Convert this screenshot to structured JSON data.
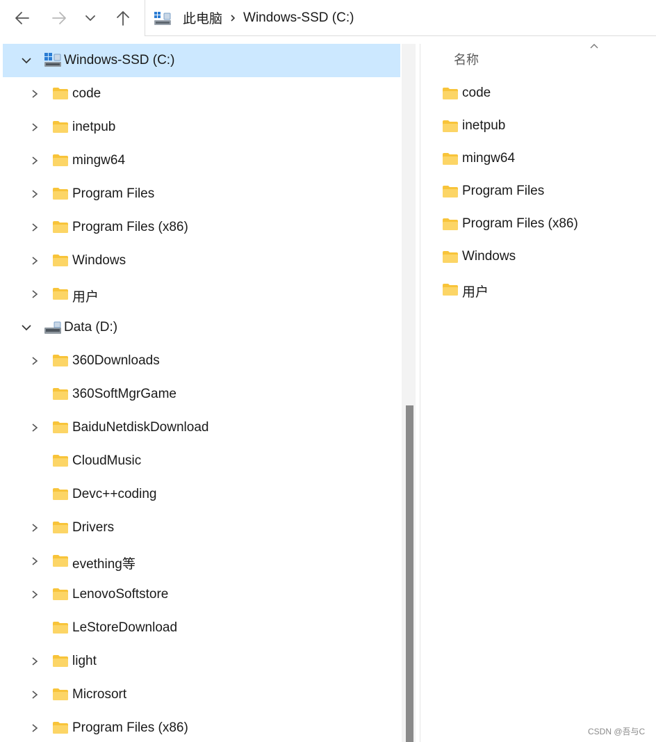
{
  "toolbar": {
    "back_icon": "arrow-left-icon",
    "forward_icon": "arrow-right-icon",
    "recent_icon": "chevron-down-icon",
    "up_icon": "arrow-up-icon"
  },
  "address_bar": {
    "icon": "this-pc-icon",
    "breadcrumbs": [
      "此电脑",
      "Windows-SSD (C:)"
    ]
  },
  "nav_tree": [
    {
      "label": "Windows-SSD (C:)",
      "type": "drive",
      "expanded": true,
      "selected": true
    },
    {
      "label": "code",
      "type": "folder",
      "has_children": true
    },
    {
      "label": "inetpub",
      "type": "folder",
      "has_children": true
    },
    {
      "label": "mingw64",
      "type": "folder",
      "has_children": true
    },
    {
      "label": "Program Files",
      "type": "folder",
      "has_children": true
    },
    {
      "label": "Program Files (x86)",
      "type": "folder",
      "has_children": true
    },
    {
      "label": "Windows",
      "type": "folder",
      "has_children": true
    },
    {
      "label": "用户",
      "type": "folder",
      "has_children": true
    },
    {
      "label": "Data (D:)",
      "type": "drive",
      "expanded": true
    },
    {
      "label": "360Downloads",
      "type": "folder",
      "has_children": true
    },
    {
      "label": "360SoftMgrGame",
      "type": "folder",
      "has_children": false
    },
    {
      "label": "BaiduNetdiskDownload",
      "type": "folder",
      "has_children": true
    },
    {
      "label": "CloudMusic",
      "type": "folder",
      "has_children": false
    },
    {
      "label": "Devc++coding",
      "type": "folder",
      "has_children": false
    },
    {
      "label": "Drivers",
      "type": "folder",
      "has_children": true
    },
    {
      "label": "evething等",
      "type": "folder",
      "has_children": true
    },
    {
      "label": "LenovoSoftstore",
      "type": "folder",
      "has_children": true
    },
    {
      "label": "LeStoreDownload",
      "type": "folder",
      "has_children": false
    },
    {
      "label": "light",
      "type": "folder",
      "has_children": true
    },
    {
      "label": "Microsort",
      "type": "folder",
      "has_children": true
    },
    {
      "label": "Program Files (x86)",
      "type": "folder",
      "has_children": true
    }
  ],
  "content": {
    "column_header": "名称",
    "sort_icon": "sort-ascending-icon",
    "items": [
      "code",
      "inetpub",
      "mingw64",
      "Program Files",
      "Program Files (x86)",
      "Windows",
      "用户"
    ]
  },
  "watermark": "CSDN @吾与C",
  "colors": {
    "selection": "#cce8ff",
    "folder_yellow": "#f8c43a",
    "scrollbar_thumb": "#8a8a8a"
  }
}
